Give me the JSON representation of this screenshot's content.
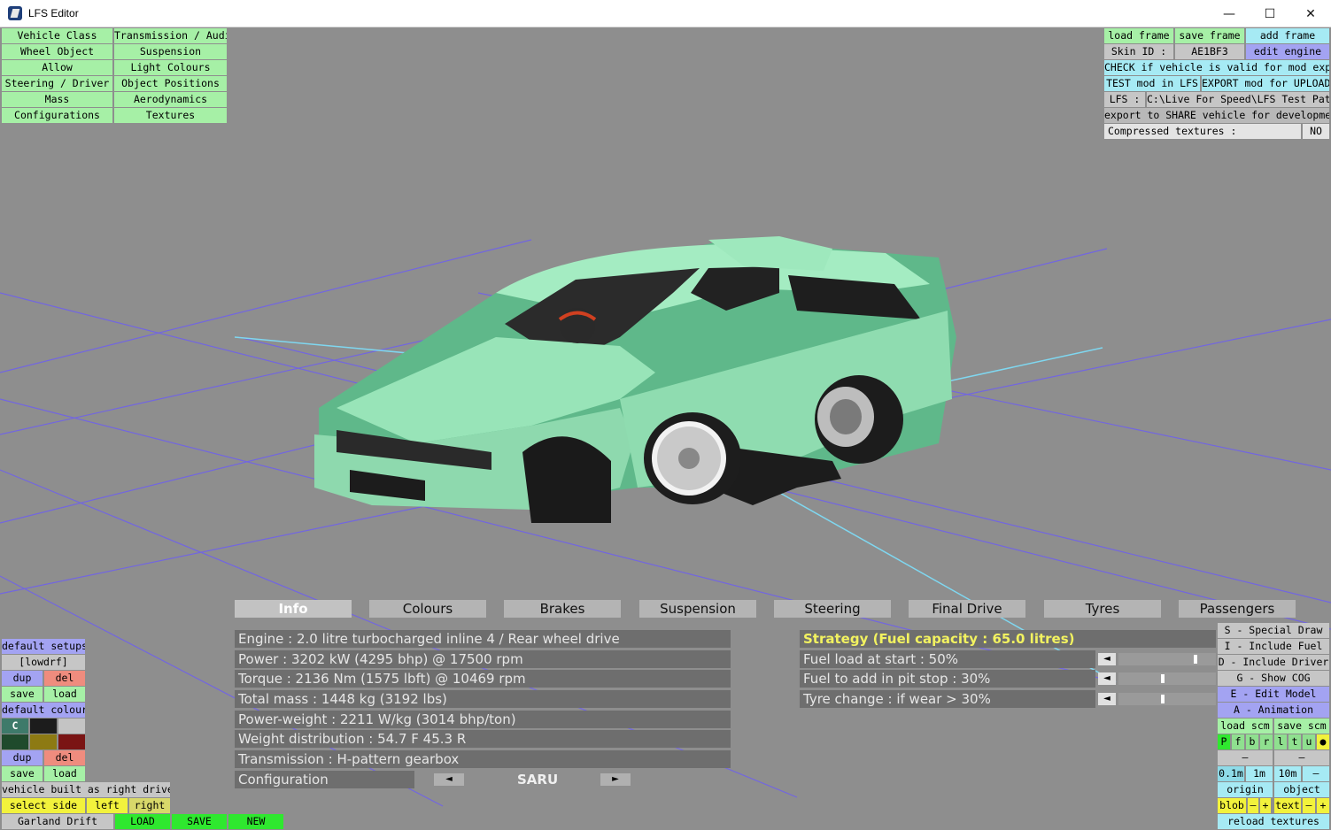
{
  "window": {
    "title": "LFS Editor",
    "minimize": "—",
    "maximize": "☐",
    "close": "✕"
  },
  "top_left_menu": [
    [
      "Vehicle Class",
      "Transmission / Audio"
    ],
    [
      "Wheel Object",
      "Suspension"
    ],
    [
      "Allow",
      "Light Colours"
    ],
    [
      "Steering / Driver",
      "Object Positions"
    ],
    [
      "Mass",
      "Aerodynamics"
    ],
    [
      "Configurations",
      "Textures"
    ]
  ],
  "top_right": {
    "load_frame": "load frame",
    "save_frame": "save frame",
    "add_frame": "add frame",
    "skin_id_label": "Skin ID :",
    "skin_id_value": "AE1BF3",
    "edit_engine": "edit engine",
    "check_valid": "CHECK if vehicle is valid for mod export",
    "test_mod": "TEST mod in LFS",
    "export_mod": "EXPORT mod for UPLOAD",
    "lfs_label": "LFS :",
    "lfs_path": "C:\\Live For Speed\\LFS Test Patch",
    "export_share": "export to SHARE vehicle for development",
    "compressed_label": "Compressed textures :",
    "compressed_value": "NO"
  },
  "tabs": [
    "Info",
    "Colours",
    "Brakes",
    "Suspension",
    "Steering",
    "Final Drive",
    "Tyres",
    "Passengers"
  ],
  "info": {
    "engine": "Engine : 2.0 litre turbocharged inline 4 / Rear wheel drive",
    "power": "Power : 3202 kW (4295 bhp) @ 17500 rpm",
    "torque": "Torque : 2136 Nm (1575 lbft) @ 10469 rpm",
    "mass": "Total mass : 1448 kg (3192 lbs)",
    "power_weight": "Power-weight : 2211 W/kg (3014 bhp/ton)",
    "weight_dist": "Weight distribution : 54.7 F  45.3 R",
    "transmission": "Transmission : H-pattern gearbox",
    "configuration_label": "Configuration",
    "configuration_value": "SARU",
    "prev": "◄",
    "next": "►"
  },
  "strategy": {
    "title": "Strategy (Fuel capacity : 65.0 litres)",
    "fuel_start": "Fuel load at start : 50%",
    "fuel_pit": "Fuel to add in pit stop : 30%",
    "tyre_change": "Tyre change : if wear > 30%",
    "left_arrow": "◄",
    "fuel_start_level": 0.8,
    "fuel_pit_level": 0.45,
    "tyre_change_level": 0.45
  },
  "right_panel": {
    "special_draw": "S - Special Draw",
    "include_fuel": "I - Include Fuel",
    "include_driver": "D - Include Driver",
    "show_cog": "G - Show COG",
    "edit_model": "E - Edit Model",
    "animation": "A - Animation",
    "load_scm": "load scm",
    "save_scm": "save scm",
    "letters": [
      "P",
      "f",
      "b",
      "r",
      "l",
      "t",
      "u",
      "●"
    ],
    "dash1": "–",
    "dash2": "–",
    "step1": "0.1m",
    "step2": "1m",
    "step3": "10m",
    "step_dash": "–",
    "origin": "origin",
    "object": "object",
    "blob": "blob",
    "minus": "–",
    "plus": "+",
    "text": "text",
    "reload_textures": "reload textures"
  },
  "left_panel": {
    "default_setups": "default setups",
    "setup_name": "[lowdrf]",
    "dup": "dup",
    "del": "del",
    "save": "save",
    "load": "load",
    "default_colours": "default colours",
    "c": "C",
    "right_drive": "vehicle built as right drive",
    "select_side": "select side",
    "left": "left",
    "right": "right",
    "vehicle_name": "Garland Drift",
    "load_btn": "LOAD",
    "save_btn": "SAVE",
    "new_btn": "NEW"
  },
  "colors": {
    "car_body": "#93e0b0",
    "background": "#8e8e8e",
    "grid": "#7a6ee6"
  }
}
